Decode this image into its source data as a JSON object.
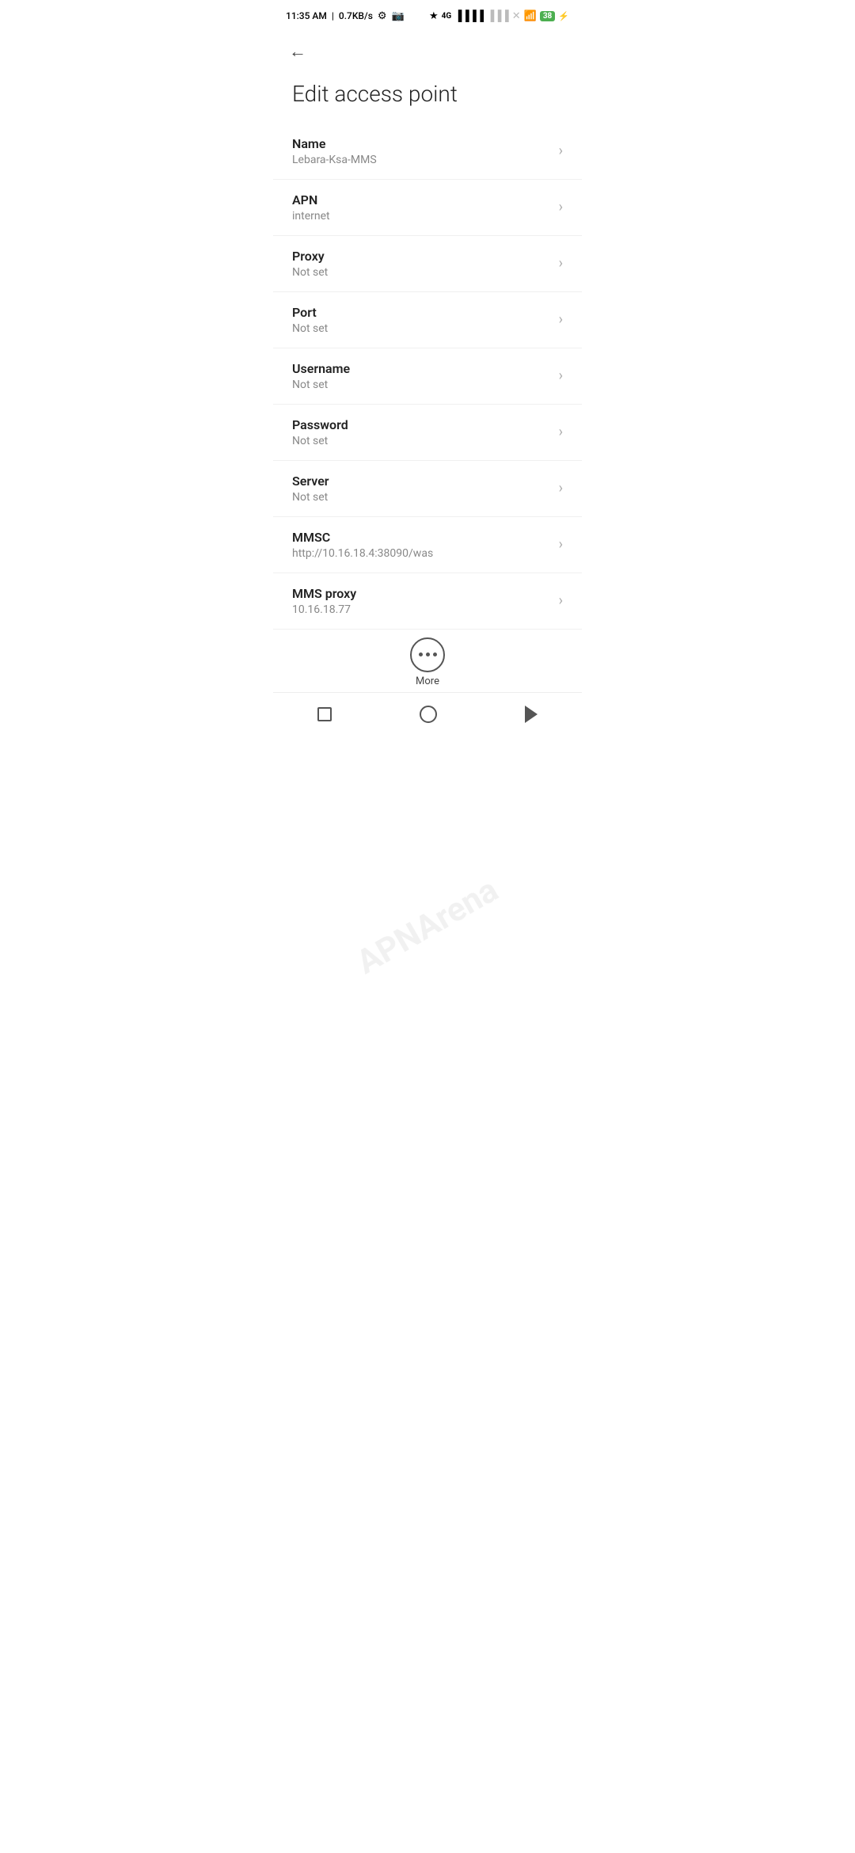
{
  "statusBar": {
    "time": "11:35 AM",
    "network": "0.7KB/s",
    "battery": "38",
    "batterySymbol": "⚡"
  },
  "page": {
    "title": "Edit access point"
  },
  "settings": [
    {
      "label": "Name",
      "value": "Lebara-Ksa-MMS"
    },
    {
      "label": "APN",
      "value": "internet"
    },
    {
      "label": "Proxy",
      "value": "Not set"
    },
    {
      "label": "Port",
      "value": "Not set"
    },
    {
      "label": "Username",
      "value": "Not set"
    },
    {
      "label": "Password",
      "value": "Not set"
    },
    {
      "label": "Server",
      "value": "Not set"
    },
    {
      "label": "MMSC",
      "value": "http://10.16.18.4:38090/was"
    },
    {
      "label": "MMS proxy",
      "value": "10.16.18.77"
    }
  ],
  "more": {
    "label": "More"
  },
  "nav": {
    "back": "◀",
    "home": "circle",
    "recent": "square"
  }
}
